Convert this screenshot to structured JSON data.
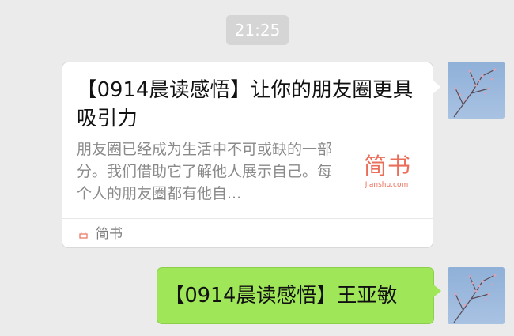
{
  "timestamp": "21:25",
  "link_message": {
    "title": "【0914晨读感悟】让你的朋友圈更具吸引力",
    "description": "朋友圈已经成为生活中不可或缺的一部分。我们借助它了解他人展示自己。每个人的朋友圈都有他自...",
    "thumbnail": {
      "main": "简书",
      "sub": "Jianshu.com"
    },
    "source": {
      "label": "简书",
      "icon": "jianshu-logo-icon"
    }
  },
  "text_message": {
    "text": "【0914晨读感悟】王亚敏"
  },
  "colors": {
    "chat_background": "#ebebeb",
    "outgoing_bubble": "#9fe658",
    "jianshu_brand": "#ea6f5a"
  }
}
